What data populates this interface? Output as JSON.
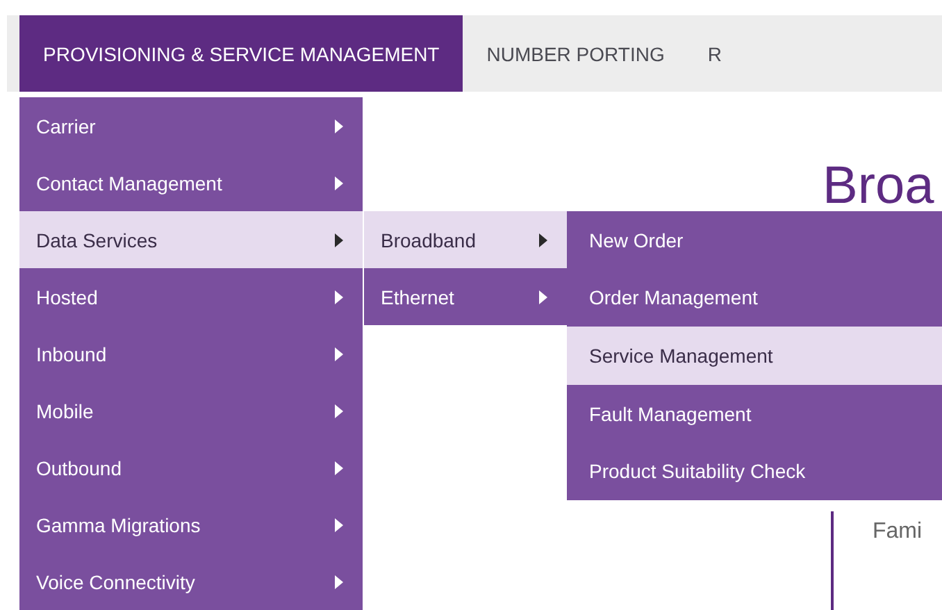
{
  "nav_tabs": [
    {
      "label": "PROVISIONING & SERVICE MANAGEMENT",
      "selected": true
    },
    {
      "label": "NUMBER PORTING",
      "selected": false
    },
    {
      "label": "R",
      "selected": false
    }
  ],
  "menu": [
    {
      "label": "Carrier",
      "selected": false,
      "has_submenu": true
    },
    {
      "label": "Contact Management",
      "selected": false,
      "has_submenu": true
    },
    {
      "label": "Data Services",
      "selected": true,
      "has_submenu": true,
      "children": [
        {
          "label": "Broadband",
          "selected": true,
          "has_submenu": true,
          "children": [
            {
              "label": "New Order",
              "selected": false,
              "has_submenu": false
            },
            {
              "label": "Order Management",
              "selected": false,
              "has_submenu": false
            },
            {
              "label": "Service Management",
              "selected": true,
              "has_submenu": false
            },
            {
              "label": "Fault Management",
              "selected": false,
              "has_submenu": false
            },
            {
              "label": "Product Suitability Check",
              "selected": false,
              "has_submenu": false
            }
          ]
        },
        {
          "label": "Ethernet",
          "selected": false,
          "has_submenu": true
        }
      ]
    },
    {
      "label": "Hosted",
      "selected": false,
      "has_submenu": true
    },
    {
      "label": "Inbound",
      "selected": false,
      "has_submenu": true
    },
    {
      "label": "Mobile",
      "selected": false,
      "has_submenu": true
    },
    {
      "label": "Outbound",
      "selected": false,
      "has_submenu": true
    },
    {
      "label": "Gamma Migrations",
      "selected": false,
      "has_submenu": true
    },
    {
      "label": "Voice Connectivity",
      "selected": false,
      "has_submenu": true
    }
  ],
  "content": {
    "heading": "Broa",
    "label": "Fami"
  }
}
